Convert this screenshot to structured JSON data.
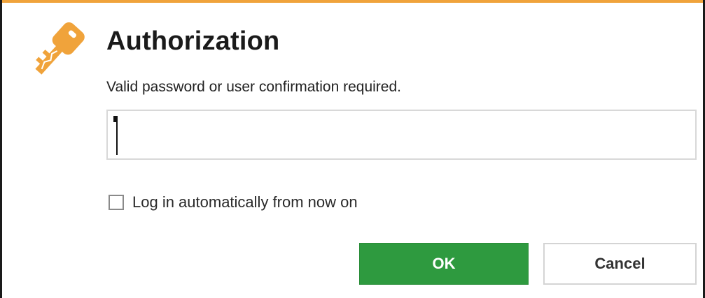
{
  "dialog": {
    "title": "Authorization",
    "message": "Valid password or user confirmation required.",
    "icon": "key-icon",
    "accent_color": "#f0a33b"
  },
  "password": {
    "value": "",
    "placeholder": ""
  },
  "auto_login": {
    "label": "Log in automatically from now on",
    "checked": false
  },
  "buttons": {
    "ok_label": "OK",
    "ok_color": "#2e9a3f",
    "cancel_label": "Cancel"
  }
}
